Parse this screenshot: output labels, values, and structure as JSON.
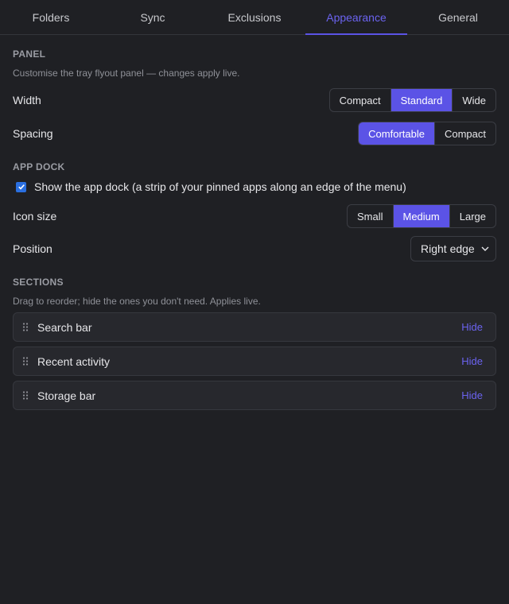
{
  "tabs": [
    {
      "label": "Folders",
      "active": false
    },
    {
      "label": "Sync",
      "active": false
    },
    {
      "label": "Exclusions",
      "active": false
    },
    {
      "label": "Appearance",
      "active": true
    },
    {
      "label": "General",
      "active": false
    }
  ],
  "panel": {
    "title": "PANEL",
    "description": "Customise the tray flyout panel — changes apply live.",
    "width": {
      "label": "Width",
      "options": [
        "Compact",
        "Standard",
        "Wide"
      ],
      "selected": "Standard"
    },
    "spacing": {
      "label": "Spacing",
      "options": [
        "Comfortable",
        "Compact"
      ],
      "selected": "Comfortable"
    }
  },
  "app_dock": {
    "title": "APP DOCK",
    "show_label": "Show the app dock (a strip of your pinned apps along an edge of the menu)",
    "show_checked": true,
    "icon_size": {
      "label": "Icon size",
      "options": [
        "Small",
        "Medium",
        "Large"
      ],
      "selected": "Medium"
    },
    "position": {
      "label": "Position",
      "value": "Right edge"
    }
  },
  "sections": {
    "title": "SECTIONS",
    "description": "Drag to reorder; hide the ones you don't need. Applies live.",
    "items": [
      {
        "label": "Search bar",
        "action": "Hide"
      },
      {
        "label": "Recent activity",
        "action": "Hide"
      },
      {
        "label": "Storage bar",
        "action": "Hide"
      }
    ]
  },
  "colors": {
    "accent": "#5b53e6",
    "link": "#6b63f0",
    "background": "#1f2024"
  }
}
